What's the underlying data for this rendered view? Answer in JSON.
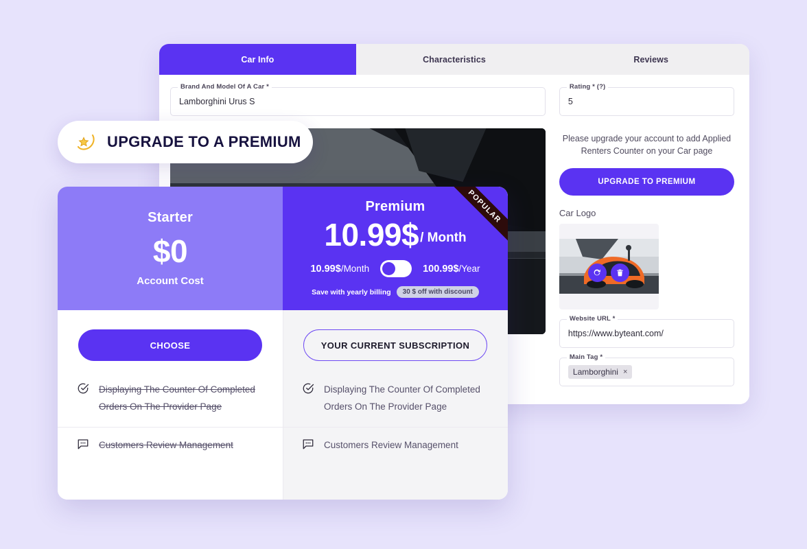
{
  "theme": {
    "page_bg": "#e7e3fc",
    "accent": "#5a33f2",
    "accent_light": "#8d7bf7",
    "panel_gray": "#f4f4f6",
    "ribbon_bg": "#2d0b0b"
  },
  "app": {
    "tabs": [
      {
        "label": "Car Info",
        "active": true
      },
      {
        "label": "Characteristics",
        "active": false
      },
      {
        "label": "Reviews",
        "active": false
      }
    ],
    "form": {
      "brand_field": {
        "label": "Brand And Model Of A Car *",
        "value": "Lamborghini Urus S",
        "placeholder": "Brand And Model Of A Car"
      },
      "rating_field": {
        "label": "Rating * (?)",
        "value": "5",
        "placeholder": "Rating"
      },
      "website_field": {
        "label": "Website URL *",
        "value": "https://www.byteant.com/",
        "placeholder": "Website URL"
      },
      "main_tag_field": {
        "label": "Main Tag *",
        "tag": "Lamborghini",
        "tag_remove": "×"
      },
      "upgrade_note": "Please upgrade your account to add Applied Renters Counter on your Car page",
      "upgrade_button": "UPGRADE TO PREMIUM",
      "car_logo_label": "Car Logo",
      "logo_actions": {
        "refresh": "refresh-icon",
        "delete": "trash-icon"
      }
    }
  },
  "upgrade_pill": {
    "icon": "shooting-star-icon",
    "label": "UPGRADE TO A PREMIUM"
  },
  "pricing": {
    "plans": [
      {
        "id": "starter",
        "name": "Starter",
        "price": "$0",
        "price_caption": "Account Cost",
        "cta": "CHOOSE",
        "cta_style": "filled",
        "features": [
          {
            "icon": "check-circle-icon",
            "text": "Displaying The Counter Of Completed Orders On The Provider Page",
            "enabled": false
          },
          {
            "icon": "chat-bubble-icon",
            "text": "Customers Review Management",
            "enabled": false
          }
        ]
      },
      {
        "id": "premium",
        "name": "Premium",
        "ribbon": "POPULAR",
        "price": "10.99$",
        "price_period": "/ Month",
        "monthly_amount": "10.99$",
        "monthly_unit": "/Month",
        "yearly_amount": "100.99$",
        "yearly_unit": "/Year",
        "toggle_state": "monthly",
        "save_text": "Save with yearly billing",
        "save_badge": "30 $ off with discount",
        "cta": "YOUR CURRENT SUBSCRIPTION",
        "cta_style": "outline",
        "features": [
          {
            "icon": "check-circle-icon",
            "text": "Displaying The Counter Of Completed Orders On The Provider Page",
            "enabled": true
          },
          {
            "icon": "chat-bubble-icon",
            "text": "Customers Review Management",
            "enabled": true
          }
        ]
      }
    ]
  }
}
